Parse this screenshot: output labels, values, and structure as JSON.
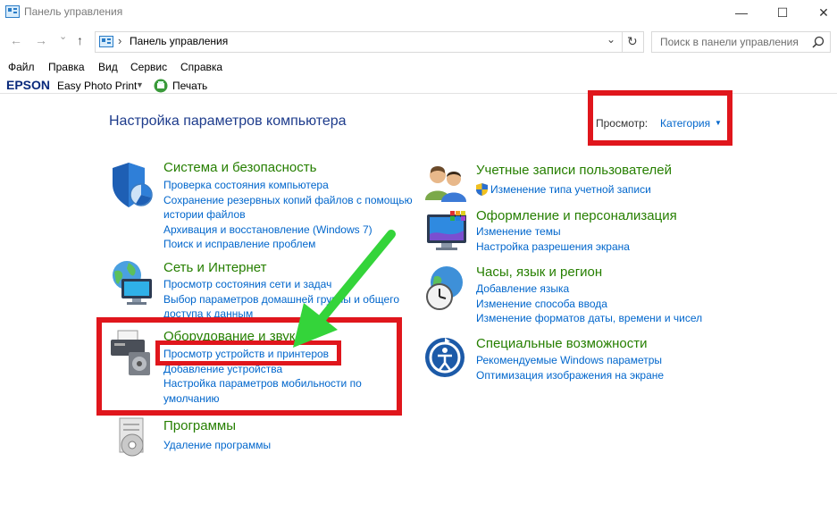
{
  "window": {
    "title": "Панель управления",
    "minimize": "—",
    "maximize": "☐",
    "close": "✕"
  },
  "nav": {
    "back": "←",
    "forward": "→",
    "recent": "⌄",
    "up": "↑",
    "breadcrumb_sep": "›",
    "address": "Панель управления",
    "dropdown": "⌄",
    "refresh": "↻",
    "search_placeholder": "Поиск в панели управления"
  },
  "menu": [
    "Файл",
    "Правка",
    "Вид",
    "Сервис",
    "Справка"
  ],
  "toolbar": {
    "brand": "EPSON",
    "app": "Easy Photo Print",
    "print": "Печать"
  },
  "main": {
    "heading": "Настройка параметров компьютера",
    "view_label": "Просмотр:",
    "view_value": "Категория"
  },
  "categories_left": [
    {
      "title": "Система и безопасность",
      "links": [
        "Проверка состояния компьютера",
        "Сохранение резервных копий файлов с помощью",
        "истории файлов",
        "Архивация и восстановление (Windows 7)",
        "Поиск и исправление проблем"
      ]
    },
    {
      "title": "Сеть и Интернет",
      "links": [
        "Просмотр состояния сети и задач",
        "Выбор параметров домашней группы и общего",
        "доступа к данным"
      ]
    },
    {
      "title": "Оборудование и звук",
      "links": [
        "Просмотр устройств и принтеров",
        "Добавление устройства",
        "Настройка параметров мобильности по",
        "умолчанию"
      ]
    },
    {
      "title": "Программы",
      "links": [
        "Удаление программы"
      ]
    }
  ],
  "categories_right": [
    {
      "title": "Учетные записи пользователей",
      "links": [
        "Изменение типа учетной записи"
      ]
    },
    {
      "title": "Оформление и персонализация",
      "links": [
        "Изменение темы",
        "Настройка разрешения экрана"
      ]
    },
    {
      "title": "Часы, язык и регион",
      "links": [
        "Добавление языка",
        "Изменение способа ввода",
        "Изменение форматов даты, времени и чисел"
      ]
    },
    {
      "title": "Специальные возможности",
      "links": [
        "Рекомендуемые Windows параметры",
        "Оптимизация изображения на экране"
      ]
    }
  ],
  "colors": {
    "category_green": "#267f00",
    "link_blue": "#0066cc",
    "highlight_red": "#e0161c",
    "arrow_green": "#34d43a"
  }
}
